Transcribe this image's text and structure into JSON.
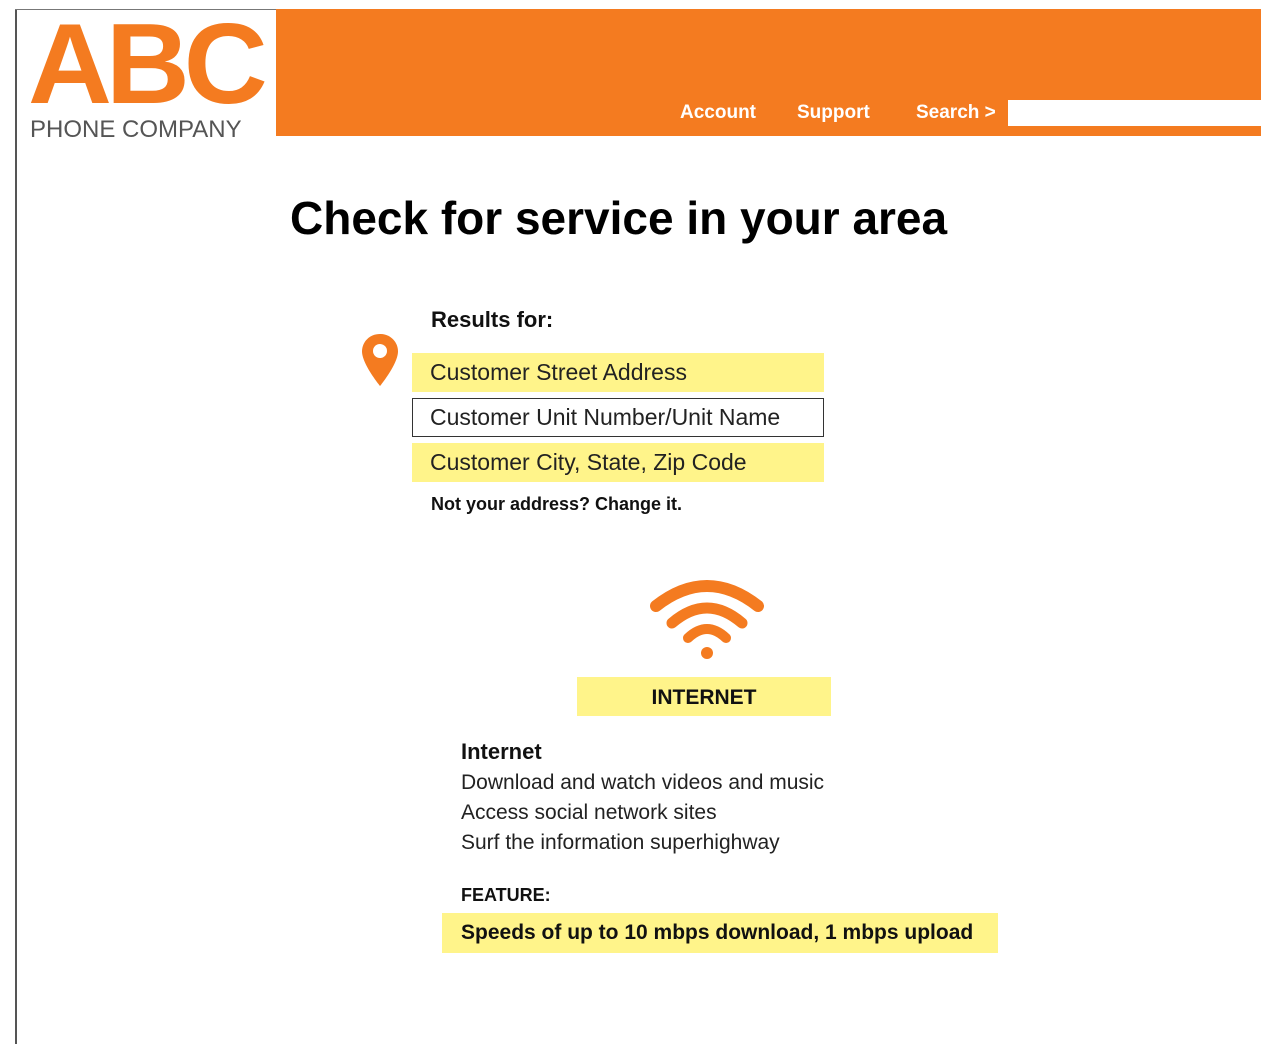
{
  "brand": {
    "logo_text": "ABC",
    "logo_subtext": "PHONE COMPANY",
    "accent_color": "#f47b20",
    "highlight_color": "#fff48a"
  },
  "nav": {
    "account": "Account",
    "support": "Support",
    "search": "Search >",
    "search_value": ""
  },
  "page": {
    "title": "Check for service in your area"
  },
  "results": {
    "label": "Results for:",
    "street_address": "Customer Street Address",
    "unit": "Customer Unit Number/Unit Name",
    "city_state_zip": "Customer  City, State, Zip Code",
    "change_link": "Not your address? Change it."
  },
  "service": {
    "icon": "wifi-icon",
    "badge": "INTERNET",
    "heading": "Internet",
    "lines": [
      "Download and watch videos and music",
      "Access social network sites",
      "Surf the information superhighway"
    ],
    "feature_label": "FEATURE:",
    "feature_text": "Speeds of up to 10 mbps download, 1 mbps upload"
  },
  "icons": {
    "location": "map-pin-icon",
    "wifi": "wifi-icon"
  }
}
